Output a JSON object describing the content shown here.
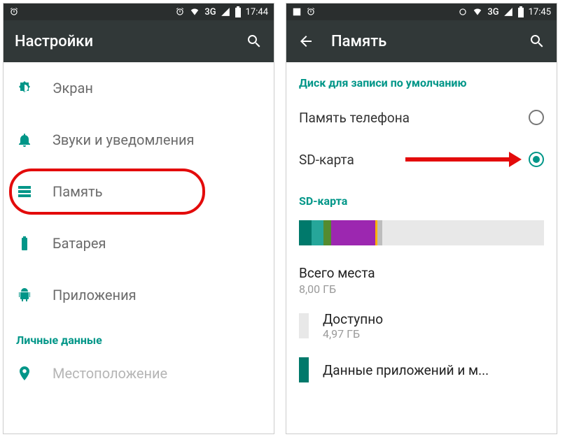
{
  "left": {
    "statusbar": {
      "time": "17:44",
      "network": "3G"
    },
    "appbar": {
      "title": "Настройки"
    },
    "rows": {
      "screen": "Экран",
      "sound": "Звуки и уведомления",
      "memory": "Память",
      "battery": "Батарея",
      "apps": "Приложения"
    },
    "section_personal": "Личные данные",
    "location": "Местоположение"
  },
  "right": {
    "statusbar": {
      "time": "17:45",
      "network": "3G"
    },
    "appbar": {
      "title": "Память"
    },
    "default_disk_header": "Диск для записи по умолчанию",
    "options": {
      "phone": "Память телефона",
      "sd": "SD-карта"
    },
    "sd_section": "SD-карта",
    "total": {
      "label": "Всего места",
      "value": "8,00 ГБ"
    },
    "available": {
      "label": "Доступно",
      "value": "4,97 ГБ"
    },
    "app_data": {
      "label": "Данные приложений и м..."
    },
    "storage_segments": [
      {
        "color": "#00796b",
        "width": 5
      },
      {
        "color": "#26a69a",
        "width": 5
      },
      {
        "color": "#558b2f",
        "width": 3
      },
      {
        "color": "#9c27b0",
        "width": 18
      },
      {
        "color": "#ffb300",
        "width": 1
      },
      {
        "color": "#bdbdbd",
        "width": 2
      }
    ]
  }
}
